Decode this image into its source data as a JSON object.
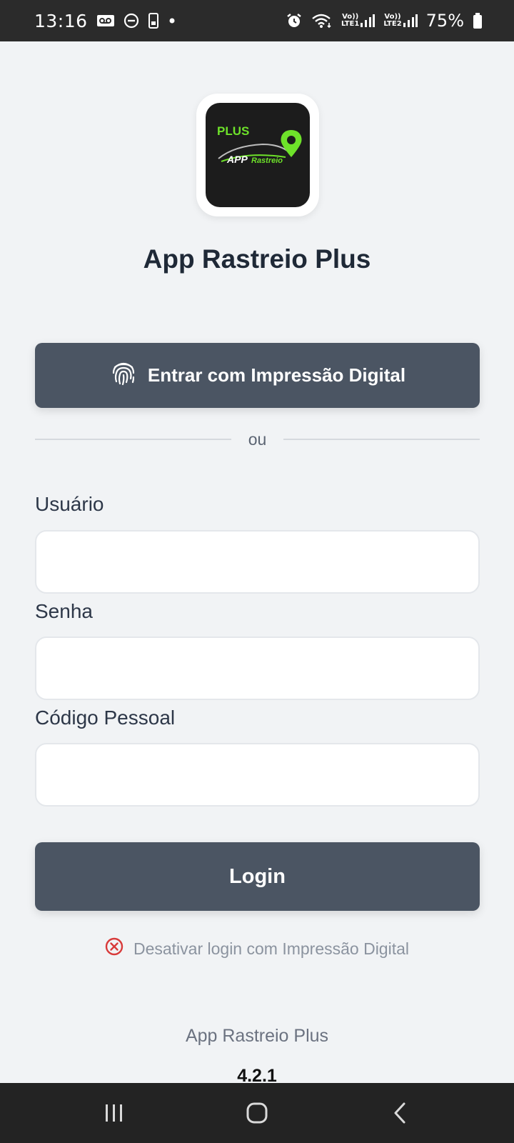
{
  "status_bar": {
    "time": "13:16",
    "battery": "75%",
    "sim1": "LTE1",
    "sim2": "LTE2",
    "volte": "Vo))",
    "icons": [
      "voicemail-icon",
      "do-not-disturb-icon",
      "phone-icon",
      "dot-icon",
      "alarm-icon",
      "wifi-icon",
      "signal-icon",
      "battery-icon"
    ]
  },
  "logo": {
    "plus_text": "PLUS",
    "app_text": "APP",
    "rastreio_text": "Rastreio",
    "accent": "#6ee22a",
    "background": "#1c1c1c"
  },
  "app_title": "App Rastreio Plus",
  "fingerprint_button": {
    "label": "Entrar com Impressão Digital",
    "icon": "fingerprint-icon"
  },
  "divider_text": "ou",
  "fields": {
    "username": {
      "label": "Usuário",
      "value": ""
    },
    "password": {
      "label": "Senha",
      "value": ""
    },
    "personal_code": {
      "label": "Código Pessoal",
      "value": ""
    }
  },
  "login_button": {
    "label": "Login"
  },
  "disable_fingerprint": {
    "label": "Desativar login com Impressão Digital",
    "icon": "close-circle-icon",
    "icon_color": "#d83a3a"
  },
  "footer": {
    "app_name": "App Rastreio Plus",
    "version": "4.2.1"
  },
  "colors": {
    "button": "#4b5563",
    "background": "#f1f3f5",
    "title": "#1f2937"
  },
  "nav_bar": {
    "buttons": [
      "recent-apps-icon",
      "home-icon",
      "back-icon"
    ]
  }
}
